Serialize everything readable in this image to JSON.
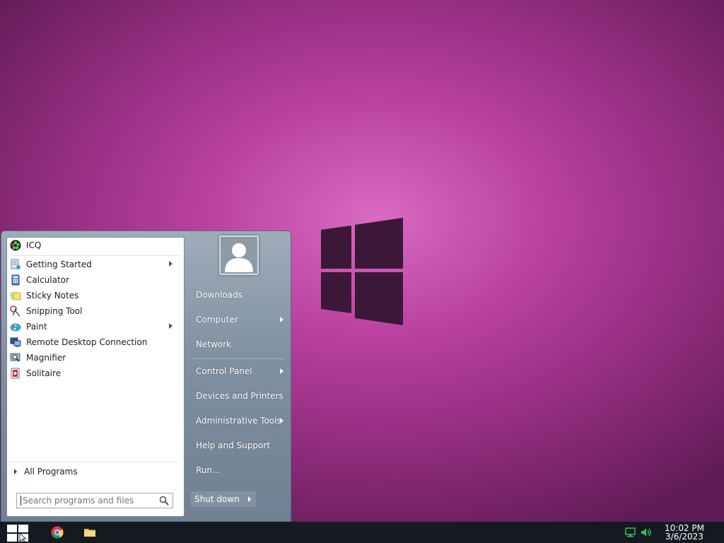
{
  "start_menu": {
    "pinned": {
      "label": "ICQ"
    },
    "programs": [
      {
        "label": "Getting Started",
        "icon": "getting-started-icon",
        "has_submenu": true
      },
      {
        "label": "Calculator",
        "icon": "calculator-icon",
        "has_submenu": false
      },
      {
        "label": "Sticky Notes",
        "icon": "sticky-notes-icon",
        "has_submenu": false
      },
      {
        "label": "Snipping Tool",
        "icon": "snipping-tool-icon",
        "has_submenu": false
      },
      {
        "label": "Paint",
        "icon": "paint-icon",
        "has_submenu": true
      },
      {
        "label": "Remote Desktop Connection",
        "icon": "remote-desktop-icon",
        "has_submenu": false
      },
      {
        "label": "Magnifier",
        "icon": "magnifier-icon",
        "has_submenu": false
      },
      {
        "label": "Solitaire",
        "icon": "solitaire-icon",
        "has_submenu": false
      }
    ],
    "all_programs": "All Programs",
    "search": {
      "placeholder": "Search programs and files"
    },
    "right": {
      "downloads": "Downloads",
      "computer": "Computer",
      "network": "Network",
      "control_panel": "Control Panel",
      "devices_printers": "Devices and Printers",
      "admin_tools": "Administrative Tools",
      "help_support": "Help and Support",
      "run": "Run..."
    },
    "shutdown": "Shut down"
  },
  "taskbar": {
    "time": "10:02 PM",
    "date": "3/6/2023"
  }
}
